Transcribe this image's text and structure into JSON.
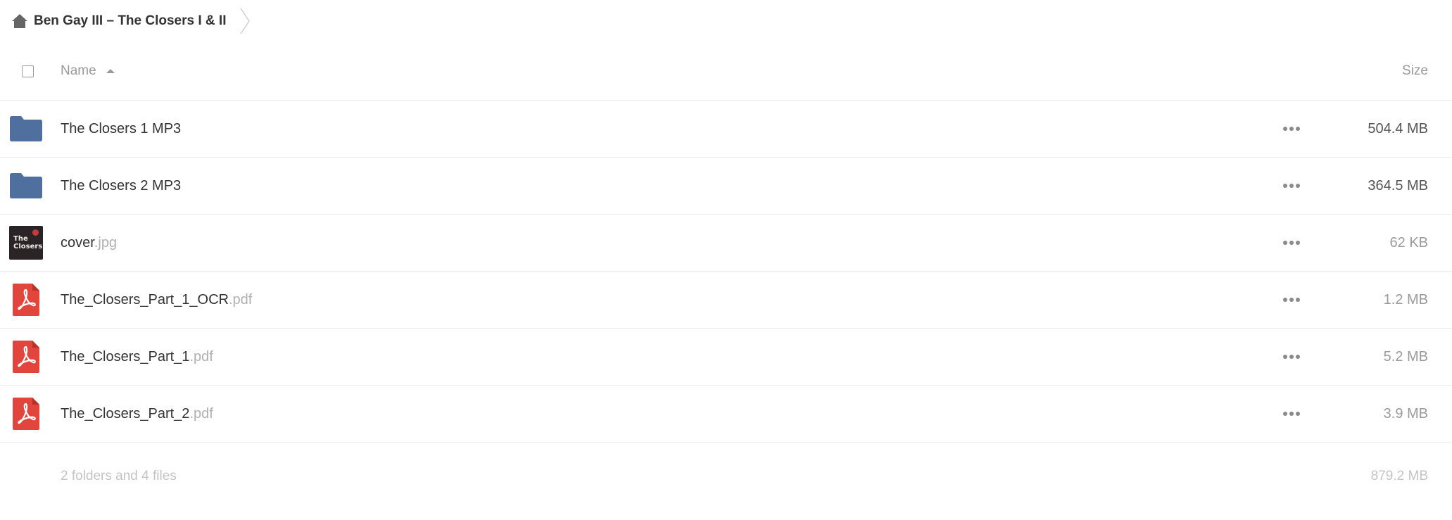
{
  "breadcrumb": {
    "home_icon": "home-icon",
    "current_folder": "Ben Gay III – The Closers I & II"
  },
  "header": {
    "name_label": "Name",
    "size_label": "Size",
    "sort_direction": "ascending"
  },
  "files": [
    {
      "name": "The Closers 1 MP3",
      "ext": "",
      "icon": "folder-icon",
      "size": "504.4 MB"
    },
    {
      "name": "The Closers 2 MP3",
      "ext": "",
      "icon": "folder-icon",
      "size": "364.5 MB"
    },
    {
      "name": "cover",
      "ext": ".jpg",
      "icon": "image-thumbnail",
      "size": "62 KB",
      "thumb_text": [
        "The",
        "Closers"
      ]
    },
    {
      "name": "The_Closers_Part_1_OCR",
      "ext": ".pdf",
      "icon": "pdf-icon",
      "size": "1.2 MB"
    },
    {
      "name": "The_Closers_Part_1",
      "ext": ".pdf",
      "icon": "pdf-icon",
      "size": "5.2 MB"
    },
    {
      "name": "The_Closers_Part_2",
      "ext": ".pdf",
      "icon": "pdf-icon",
      "size": "3.9 MB"
    }
  ],
  "summary": {
    "text": "2 folders and 4 files",
    "total_size": "879.2 MB"
  },
  "colors": {
    "folder": "#4f6f9e",
    "pdf": "#e2453b",
    "muted_text": "#9a9a9a",
    "divider": "#ececec"
  }
}
